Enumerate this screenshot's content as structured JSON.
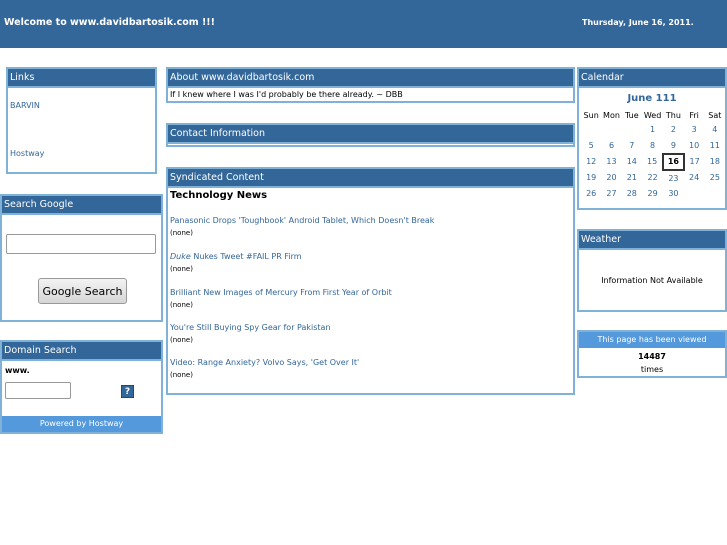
{
  "header": {
    "welcome": "Welcome to www.davidbartosik.com !!!",
    "date": "Thursday, June 16, 2011."
  },
  "links_box": {
    "title": "Links",
    "items": [
      "BARVIN",
      "Hostway"
    ]
  },
  "google_search": {
    "title": "Search Google",
    "query": "",
    "button_label": "Google Search"
  },
  "domain_search": {
    "title": "Domain Search",
    "prefix": "www.",
    "query": "",
    "go_label": "?",
    "powered_by": "Powered by Hostway"
  },
  "about": {
    "title": "About www.davidbartosik.com",
    "text": "If I knew where I was I'd probably be there already. ~ DBB"
  },
  "contact": {
    "title": "Contact Information"
  },
  "syndicated": {
    "title": "Syndicated Content",
    "section_title": "Technology News",
    "items": [
      {
        "title": "Panasonic Drops 'Toughbook' Android Tablet, Which Doesn't Break",
        "sub": "(none)"
      },
      {
        "title_em": "Duke",
        "title": " Nukes Tweet #FAIL PR Firm",
        "sub": "(none)"
      },
      {
        "title": "Brilliant New Images of Mercury From First Year of Orbit",
        "sub": "(none)"
      },
      {
        "title": "You're Still Buying Spy Gear for Pakistan",
        "sub": "(none)"
      },
      {
        "title": "Video: Range Anxiety? Volvo Says, 'Get Over It'",
        "sub": "(none)"
      }
    ]
  },
  "calendar": {
    "title": "Calendar",
    "month": "June 111",
    "weekdays": [
      "Sun",
      "Mon",
      "Tue",
      "Wed",
      "Thu",
      "Fri",
      "Sat"
    ],
    "weeks": [
      [
        "",
        "",
        "",
        "1",
        "2",
        "3",
        "4"
      ],
      [
        "5",
        "6",
        "7",
        "8",
        "9",
        "10",
        "11"
      ],
      [
        "12",
        "13",
        "14",
        "15",
        "16",
        "17",
        "18"
      ],
      [
        "19",
        "20",
        "21",
        "22",
        "23",
        "24",
        "25"
      ],
      [
        "26",
        "27",
        "28",
        "29",
        "30",
        "",
        ""
      ]
    ],
    "today": "16"
  },
  "weather": {
    "title": "Weather",
    "message": "Information Not Available"
  },
  "counter": {
    "title": "This page has been viewed",
    "count": "14487",
    "unit": "times"
  },
  "colors": {
    "header_blue": "#336699",
    "border_light": "#7fb2d6",
    "accent_light": "#5599dd"
  }
}
